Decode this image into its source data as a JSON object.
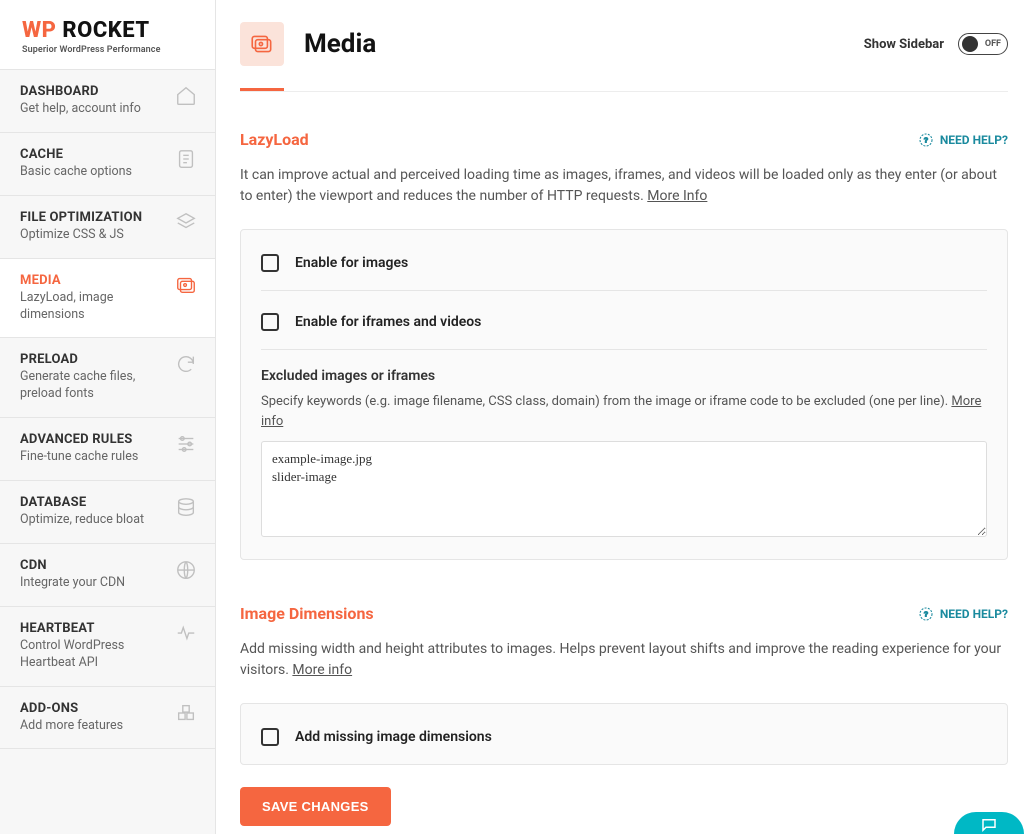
{
  "brand": {
    "wp": "WP",
    "rocket": " ROCKET",
    "tagline": "Superior WordPress Performance"
  },
  "sidebar": {
    "items": [
      {
        "title": "DASHBOARD",
        "desc": "Get help, account info"
      },
      {
        "title": "CACHE",
        "desc": "Basic cache options"
      },
      {
        "title": "FILE OPTIMIZATION",
        "desc": "Optimize CSS & JS"
      },
      {
        "title": "MEDIA",
        "desc": "LazyLoad, image dimensions"
      },
      {
        "title": "PRELOAD",
        "desc": "Generate cache files, preload fonts"
      },
      {
        "title": "ADVANCED RULES",
        "desc": "Fine-tune cache rules"
      },
      {
        "title": "DATABASE",
        "desc": "Optimize, reduce bloat"
      },
      {
        "title": "CDN",
        "desc": "Integrate your CDN"
      },
      {
        "title": "HEARTBEAT",
        "desc": "Control WordPress Heartbeat API"
      },
      {
        "title": "ADD-ONS",
        "desc": "Add more features"
      }
    ]
  },
  "page": {
    "title": "Media",
    "show_sidebar_label": "Show Sidebar",
    "toggle_text": "OFF"
  },
  "lazyload": {
    "title": "LazyLoad",
    "help": "NEED HELP?",
    "desc": "It can improve actual and perceived loading time as images, iframes, and videos will be loaded only as they enter (or about to enter) the viewport and reduces the number of HTTP requests. ",
    "more_info": "More Info",
    "enable_images": "Enable for images",
    "enable_iframes": "Enable for iframes and videos",
    "excluded_title": "Excluded images or iframes",
    "excluded_desc": "Specify keywords (e.g. image filename, CSS class, domain) from the image or iframe code to be excluded (one per line). ",
    "excluded_more": "More info",
    "excluded_value": "example-image.jpg\nslider-image"
  },
  "dimensions": {
    "title": "Image Dimensions",
    "help": "NEED HELP?",
    "desc": "Add missing width and height attributes to images. Helps prevent layout shifts and improve the reading experience for your visitors. ",
    "more_info": "More info",
    "add_missing": "Add missing image dimensions"
  },
  "save_label": "SAVE CHANGES"
}
